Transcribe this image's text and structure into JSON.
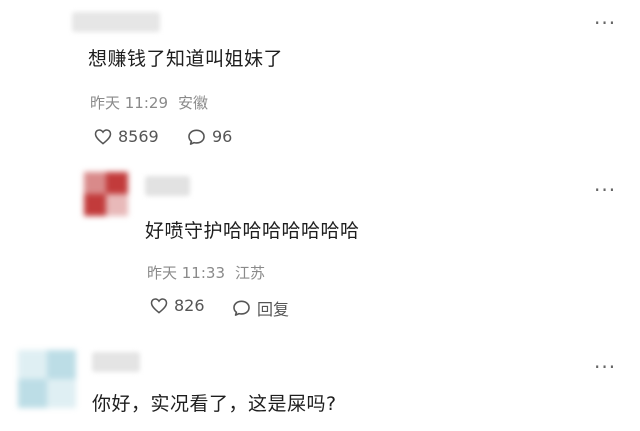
{
  "comments": [
    {
      "text": "想赚钱了知道叫姐妹了",
      "time": "昨天 11:29",
      "location": "安徽",
      "likes": "8569",
      "replies": "96",
      "more_icon": "more-dots-icon"
    },
    {
      "text": "好喷守护哈哈哈哈哈哈哈",
      "time": "昨天 11:33",
      "location": "江苏",
      "likes": "826",
      "reply_label": "回复",
      "more_icon": "more-dots-icon",
      "avatar_colors": [
        "#c23b3b",
        "#e8b9b9",
        "#d98a8a"
      ]
    },
    {
      "text": "你好，实况看了，这是屎吗?",
      "more_icon": "more-dots-icon",
      "avatar_colors": [
        "#bcdde6",
        "#dfeff3"
      ]
    }
  ],
  "icons": {
    "like": "heart-outline-icon",
    "comment": "speech-bubble-icon"
  }
}
